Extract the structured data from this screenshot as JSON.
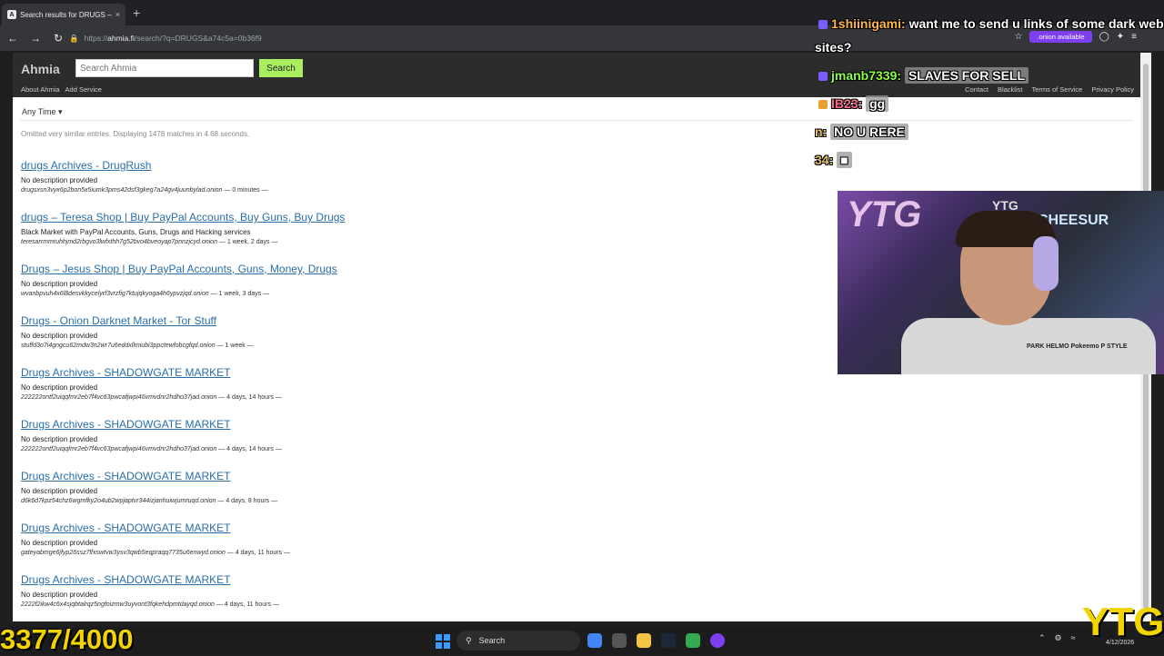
{
  "browser": {
    "tab_title": "Search results for DRUGS — Ah",
    "tab_close": "×",
    "new_tab": "+",
    "url_prefix": "https://",
    "url_host": "ahmia.fi",
    "url_path": "/search/?q=DRUGS&a74c5a=0b36f9",
    "onion_pill": ".onion available"
  },
  "site": {
    "logo": "Ahmia",
    "search_placeholder": "Search Ahmia",
    "search_button": "Search",
    "links_left": [
      "About Ahmia",
      "Add Service"
    ],
    "links_right": [
      "Contact",
      "Blacklist",
      "Terms of Service",
      "Privacy Policy"
    ],
    "filter": "Any Time ▾",
    "summary": "Omitted very similar entries. Displaying 1478 matches in 4.68 seconds."
  },
  "results": [
    {
      "title": "drugs Archives - DrugRush",
      "desc": "No description provided",
      "onion": "drugsxsn3vyx6p2bon5x5iumk3pms42dsf3gkeg7a24gv4juunbylad.onion",
      "age": "— 0 minutes —"
    },
    {
      "title": "drugs – Teresa Shop | Buy PayPal Accounts, Buy Guns, Buy Drugs",
      "desc": "Black Market with PayPal Accounts, Guns, Drugs and Hacking services",
      "onion": "teresarrmmruhhjmd2rbgvo3lwfxthh7g52bvo4bveoyap7pnnzjcyd.onion",
      "age": "— 1 week, 2 days —"
    },
    {
      "title": "Drugs – Jesus Shop | Buy PayPal Accounts, Guns, Money, Drugs",
      "desc": "No description provided",
      "onion": "wvanbpvuh4x6l8desvkkycelyrf3vrzfig7ktujqkyoga4h6ypvzjqd.onion",
      "age": "— 1 week, 3 days —"
    },
    {
      "title": "Drugs - Onion Darknet Market - Tor Stuff",
      "desc": "No description provided",
      "onion": "stuffd3o7i4gngcu62mdw3n2wr7u6eddxllmiubi3ppctewfobcgfqd.onion",
      "age": "— 1 week —"
    },
    {
      "title": "Drugs Archives - SHADOWGATE MARKET",
      "desc": "No description provided",
      "onion": "222222ontf2uiqqfmr2eb7f4vc63pwcafjwpi46vmvdnr2hdho37jad.onion",
      "age": "— 4 days, 14 hours —"
    },
    {
      "title": "Drugs Archives - SHADOWGATE MARKET",
      "desc": "No description provided",
      "onion": "222222ontf2uiqqfmr2eb7f4vc63pwcafjwpi46vmvdnr2hdho37jad.onion",
      "age": "— 4 days, 14 hours —"
    },
    {
      "title": "Drugs Archives - SHADOWGATE MARKET",
      "desc": "No description provided",
      "onion": "d6k6d7kpz54chz6wgmfky2o4ub2wpjaptvr344izjanhuiwjumruqd.onion",
      "age": "— 4 days, 8 hours —"
    },
    {
      "title": "Drugs Archives - SHADOWGATE MARKET",
      "desc": "No description provided",
      "onion": "gateyabmge6jfyp26ssz7lfxswtvw3ysv3qwb5eqpraqq7735u6enwyd.onion",
      "age": "— 4 days, 11 hours —"
    },
    {
      "title": "Drugs Archives - SHADOWGATE MARKET",
      "desc": "No description provided",
      "onion": "2222f2ikw4c6x4sjqbtalrqz5ngfoizmw3uyvont3fqkehdpmtdayqd.onion",
      "age": "— 4 days, 11 hours —"
    }
  ],
  "chat": [
    {
      "user": "1shiinigami:",
      "msg": "want me to send u links of some dark web",
      "msg2": "sites?"
    },
    {
      "user": "jmanb7339:",
      "msg": "SLAVES FOR SELL"
    },
    {
      "user": "IB23:",
      "msg": "gg"
    },
    {
      "user": "n:",
      "msg": "NO U RERE"
    },
    {
      "user": "34:",
      "msg": ""
    }
  ],
  "webcam": {
    "sign": "YTG",
    "sign2": "YTG",
    "neon": "CHEESUR",
    "shirt_text": "PARK HELMO Pokeemo P STYLE"
  },
  "overlay": {
    "counter": "3377/4000",
    "logo": "YTG"
  },
  "taskbar": {
    "search_label": "Search",
    "date": "4/12/2026"
  }
}
